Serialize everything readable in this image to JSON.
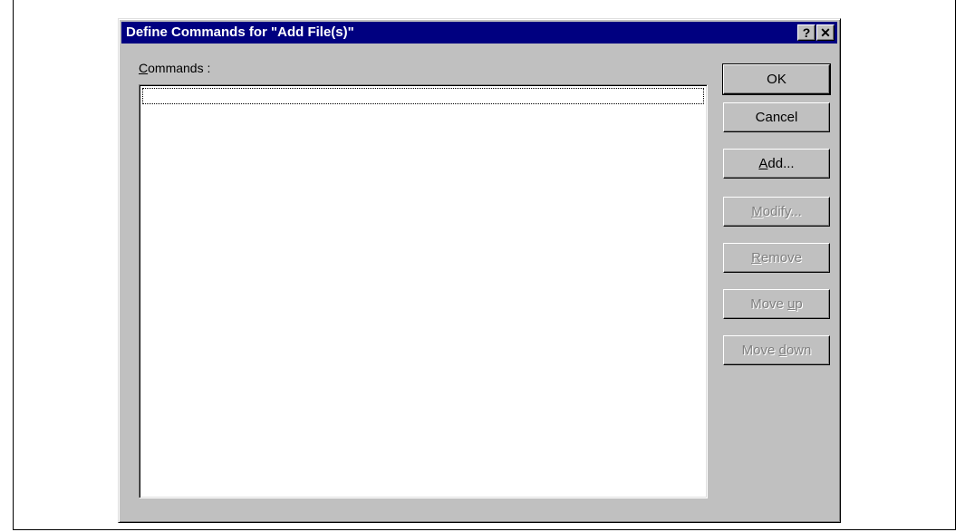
{
  "dialog": {
    "title": "Define Commands for \"Add File(s)\"",
    "help_button": "?",
    "close_button": "✕"
  },
  "commands": {
    "label_accel": "C",
    "label_rest": "ommands :",
    "items": []
  },
  "buttons": {
    "ok": {
      "label": "OK"
    },
    "cancel": {
      "label": "Cancel"
    },
    "add": {
      "pre": "",
      "accel": "A",
      "post": "dd..."
    },
    "modify": {
      "pre": "",
      "accel": "M",
      "post": "odify..."
    },
    "remove": {
      "pre": "",
      "accel": "R",
      "post": "emove"
    },
    "move_up": {
      "pre": "Move ",
      "accel": "u",
      "post": "p"
    },
    "move_down": {
      "pre": "Move ",
      "accel": "d",
      "post": "own"
    }
  },
  "colors": {
    "titlebar": "#000080",
    "face": "#c0c0c0",
    "disabled_text": "#808080"
  }
}
